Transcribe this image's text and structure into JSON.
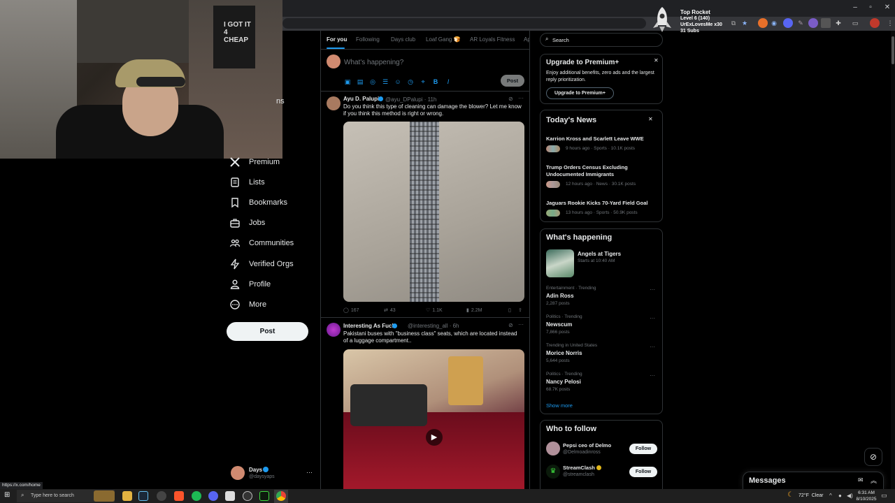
{
  "overlay": {
    "title": "Top Rocket",
    "level": "Level 6  (140)",
    "user": "UrExLovesMe x30",
    "subs": "31 Subs"
  },
  "tabs": [
    {
      "label": "For you"
    },
    {
      "label": "Following"
    },
    {
      "label": "Days club"
    },
    {
      "label": "Loaf Gang 🍞"
    },
    {
      "label": "AR Loyals Fitness"
    },
    {
      "label": "Ap"
    }
  ],
  "composer": {
    "placeholder": "What's happening?",
    "post_label": "Post"
  },
  "nav": [
    {
      "label": "ns"
    },
    {
      "label": "Premium",
      "icon": "x-logo-icon"
    },
    {
      "label": "Lists",
      "icon": "lists-icon"
    },
    {
      "label": "Bookmarks",
      "icon": "bookmark-icon"
    },
    {
      "label": "Jobs",
      "icon": "briefcase-icon"
    },
    {
      "label": "Communities",
      "icon": "communities-icon"
    },
    {
      "label": "Verified Orgs",
      "icon": "lightning-icon"
    },
    {
      "label": "Profile",
      "icon": "person-icon"
    },
    {
      "label": "More",
      "icon": "more-circle-icon"
    }
  ],
  "nav_post_label": "Post",
  "account": {
    "name": "Days",
    "handle": "@daysyaps"
  },
  "tweets": [
    {
      "name": "Ayu D. Palupi",
      "handle": "@ayu_DPalupi · 11h",
      "text": "Do you think this type of cleaning can damage the blower? Let me know if you think this method is right or wrong.",
      "replies": "167",
      "reposts": "43",
      "likes": "1.1K",
      "views": "2.2M"
    },
    {
      "name": "Interesting As Fuck",
      "handle": "@interesting_all · 6h",
      "text": "Pakistani buses with \"business class\" seats, which are located instead of a luggage compartment.."
    }
  ],
  "search": {
    "placeholder": "Search"
  },
  "premium": {
    "title": "Upgrade to Premium+",
    "body": "Enjoy additional benefits, zero ads and the largest reply prioritization.",
    "button": "Upgrade to Premium+"
  },
  "news": {
    "title": "Today's News",
    "items": [
      {
        "title": "Karrion Kross and Scarlett Leave WWE",
        "meta": "9 hours ago · Sports · 10.1K posts"
      },
      {
        "title": "Trump Orders Census Excluding Undocumented Immigrants",
        "meta": "12 hours ago · News · 30.1K posts"
      },
      {
        "title": "Jaguars Rookie Kicks 70-Yard Field Goal",
        "meta": "13 hours ago · Sports · 50.9K posts"
      }
    ]
  },
  "happening": {
    "title": "What's happening",
    "event": {
      "name": "Angels at Tigers",
      "time": "Starts at 10:40 AM"
    },
    "trends": [
      {
        "cat": "Entertainment · Trending",
        "name": "Adin Ross",
        "count": "2,287 posts"
      },
      {
        "cat": "Politics · Trending",
        "name": "Newscum",
        "count": "7,866 posts"
      },
      {
        "cat": "Trending in United States",
        "name": "Morice Norris",
        "count": "5,644 posts"
      },
      {
        "cat": "Politics · Trending",
        "name": "Nancy Pelosi",
        "count": "68.7K posts"
      }
    ],
    "show_more": "Show more"
  },
  "who_to_follow": {
    "title": "Who to follow",
    "items": [
      {
        "name": "Pepsi ceo of Delmo",
        "handle": "@Delmoadinross",
        "button": "Follow"
      },
      {
        "name": "StreamClash",
        "handle": "@streamclash",
        "button": "Follow"
      }
    ]
  },
  "messages": {
    "title": "Messages"
  },
  "status_url": "https://x.com/home",
  "taskbar": {
    "search_placeholder": "Type here to search",
    "weather": "72°F  Clear",
    "time": "6:31 AM",
    "date": "8/10/2025"
  },
  "colors": {
    "accent": "#1d9bf0",
    "bg": "#000000",
    "border": "#2f3336",
    "muted": "#71767b"
  }
}
